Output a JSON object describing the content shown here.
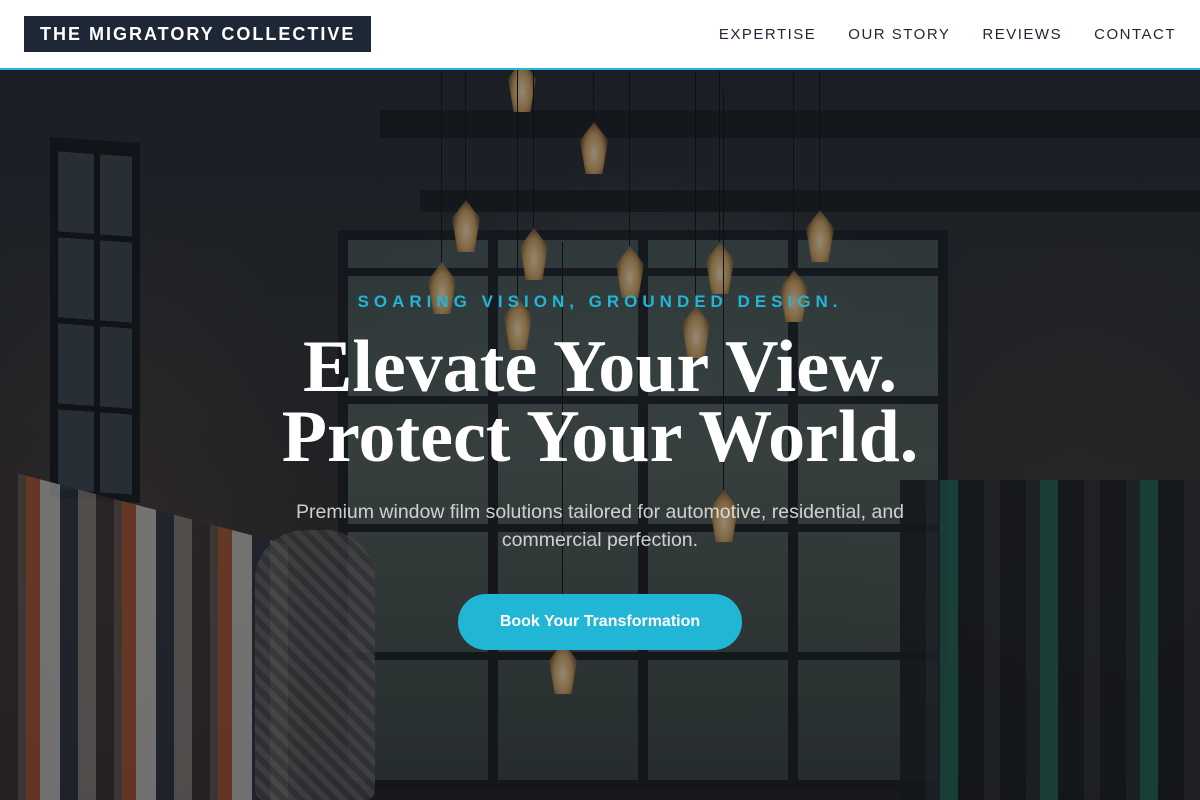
{
  "header": {
    "logo_text": "THE MIGRATORY COLLECTIVE",
    "nav": [
      {
        "label": "EXPERTISE"
      },
      {
        "label": "OUR STORY"
      },
      {
        "label": "REVIEWS"
      },
      {
        "label": "CONTACT"
      }
    ]
  },
  "hero": {
    "tagline": "SOARING VISION, GROUNDED DESIGN.",
    "headline_line1": "Elevate Your View.",
    "headline_line2": "Protect Your World.",
    "subtext": "Premium window film solutions tailored for automotive, residential, and commercial perfection.",
    "cta_label": "Book Your Transformation",
    "background_image": "boutique-interior-with-pendant-lamps"
  },
  "colors": {
    "accent": "#21b6d6",
    "logo_bg": "#1e2736",
    "header_bg": "#ffffff",
    "nav_text": "#1e2736"
  }
}
